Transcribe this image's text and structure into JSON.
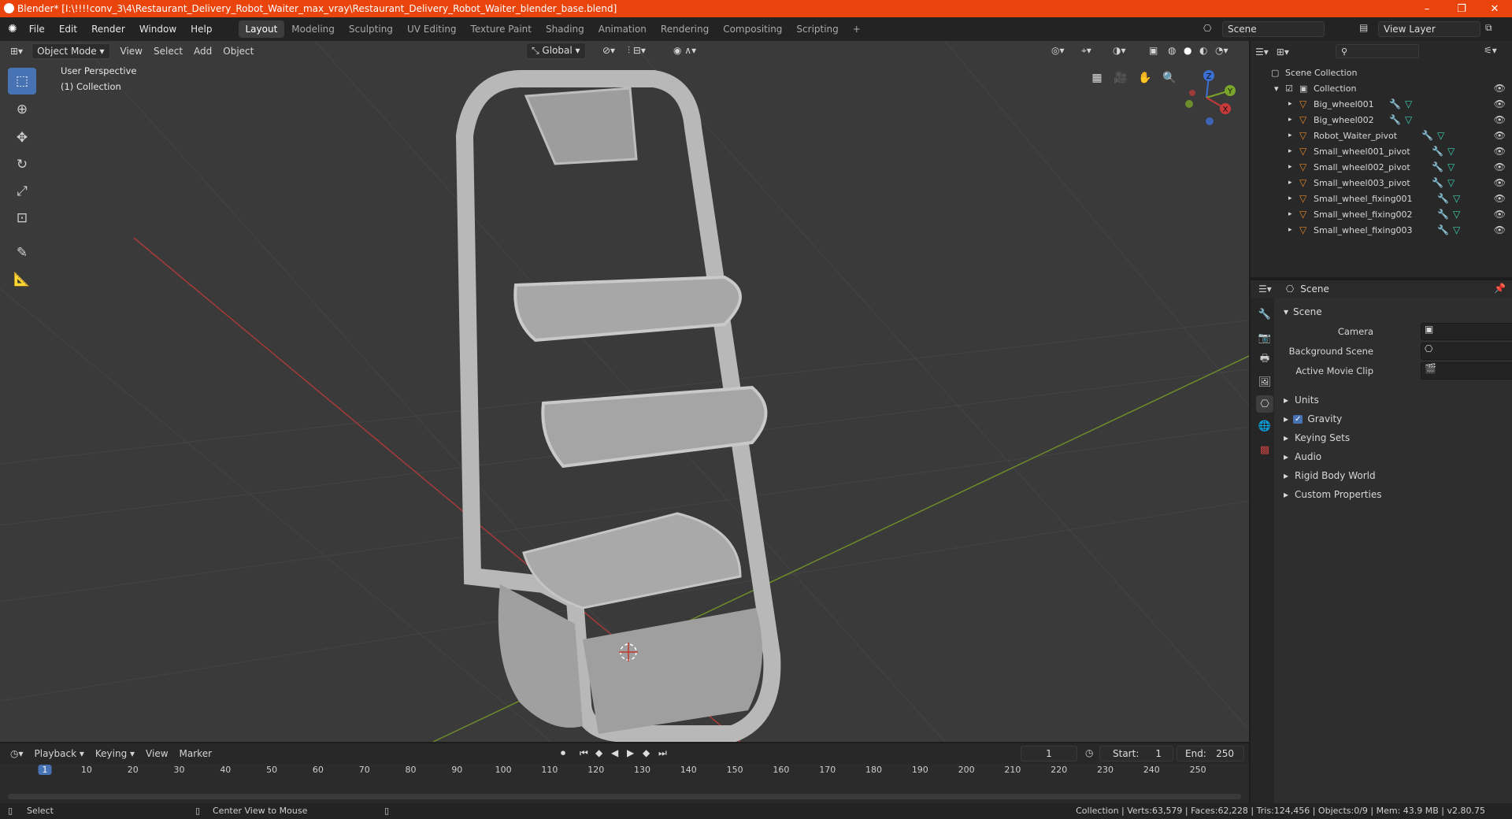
{
  "window": {
    "title": "Blender* [I:\\!!!!conv_3\\4\\Restaurant_Delivery_Robot_Waiter_max_vray\\Restaurant_Delivery_Robot_Waiter_blender_base.blend]",
    "minimize": "–",
    "maximize": "❐",
    "close": "✕"
  },
  "menubar": {
    "menus": [
      "File",
      "Edit",
      "Render",
      "Window",
      "Help"
    ],
    "workspaces": [
      "Layout",
      "Modeling",
      "Sculpting",
      "UV Editing",
      "Texture Paint",
      "Shading",
      "Animation",
      "Rendering",
      "Compositing",
      "Scripting"
    ],
    "active_workspace": "Layout",
    "add_workspace": "+",
    "scene_name": "Scene",
    "view_layer": "View Layer"
  },
  "viewport": {
    "mode": "Object Mode",
    "menus": [
      "View",
      "Select",
      "Add",
      "Object"
    ],
    "orientation": "Global",
    "overlay_title": "User Perspective",
    "overlay_collection": "(1) Collection",
    "gizmo": {
      "x": "X",
      "y": "Y",
      "z": "Z"
    }
  },
  "outliner": {
    "search_placeholder": "",
    "root": "Scene Collection",
    "collection": "Collection",
    "objects": [
      "Big_wheel001",
      "Big_wheel002",
      "Robot_Waiter_pivot",
      "Small_wheel001_pivot",
      "Small_wheel002_pivot",
      "Small_wheel003_pivot",
      "Small_wheel_fixing001",
      "Small_wheel_fixing002",
      "Small_wheel_fixing003"
    ]
  },
  "properties": {
    "context": "Scene",
    "panel": "Scene",
    "fields": {
      "camera": "Camera",
      "background_scene": "Background Scene",
      "active_movie_clip": "Active Movie Clip"
    },
    "subpanels": [
      "Units",
      "Gravity",
      "Keying Sets",
      "Audio",
      "Rigid Body World",
      "Custom Properties"
    ],
    "gravity_checked": true
  },
  "timeline": {
    "menus": [
      "Playback",
      "Keying",
      "View",
      "Marker"
    ],
    "current_frame": "1",
    "start_label": "Start:",
    "start": "1",
    "end_label": "End:",
    "end": "250",
    "ticks": [
      "1",
      "10",
      "20",
      "30",
      "40",
      "50",
      "60",
      "70",
      "80",
      "90",
      "100",
      "110",
      "120",
      "130",
      "140",
      "150",
      "160",
      "170",
      "180",
      "190",
      "200",
      "210",
      "220",
      "230",
      "240",
      "250"
    ]
  },
  "statusbar": {
    "left_action": "Select",
    "middle_action": "Center View to Mouse",
    "stats": "Collection | Verts:63,579 | Faces:62,228 | Tris:124,456 | Objects:0/9 | Mem: 43.9 MB | v2.80.75"
  },
  "colors": {
    "accent": "#4772b3",
    "titlebar": "#e8440c",
    "object_icon": "#e8852a"
  }
}
